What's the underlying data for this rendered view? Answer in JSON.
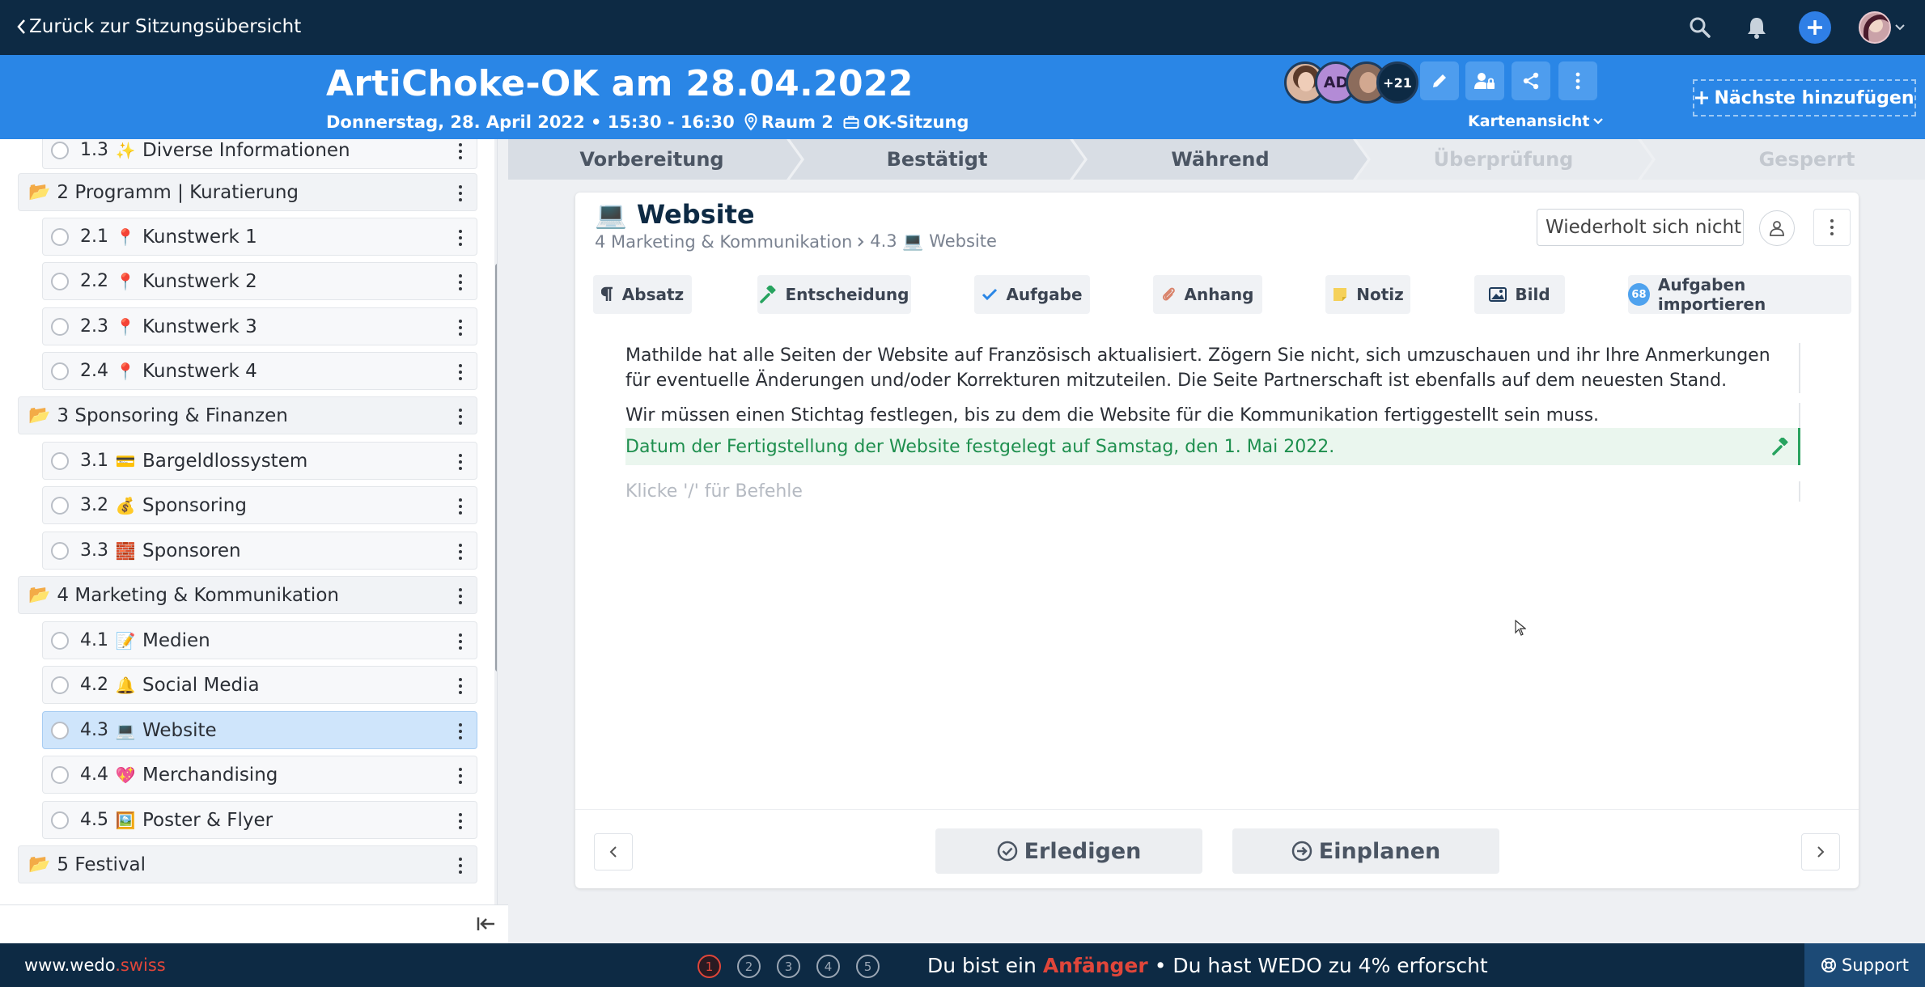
{
  "topbar": {
    "back_label": "Zurück zur Sitzungsübersicht",
    "icons": [
      "search-icon",
      "bell-icon",
      "plus-icon",
      "user-avatar"
    ]
  },
  "meeting": {
    "title": "ArtiChoke-OK am 28.04.2022",
    "date_time": "Donnerstag, 28. April 2022 • 15:30 - 16:30",
    "room": "Raum 2",
    "type": "OK-Sitzung",
    "participants": [
      "",
      "AD",
      "",
      "+21"
    ],
    "view_label": "Kartenansicht",
    "add_next_label": "Nächste hinzufügen"
  },
  "sidebar": {
    "sections": [
      {
        "kind": "item",
        "number": "1.3",
        "emoji": "✨",
        "label": "Diverse Informationen"
      },
      {
        "kind": "section",
        "label": "2 Programm | Kuratierung"
      },
      {
        "kind": "item",
        "number": "2.1",
        "emoji": "📍",
        "label": "Kunstwerk 1"
      },
      {
        "kind": "item",
        "number": "2.2",
        "emoji": "📍",
        "label": "Kunstwerk 2"
      },
      {
        "kind": "item",
        "number": "2.3",
        "emoji": "📍",
        "label": "Kunstwerk 3"
      },
      {
        "kind": "item",
        "number": "2.4",
        "emoji": "📍",
        "label": "Kunstwerk 4"
      },
      {
        "kind": "section",
        "label": "3 Sponsoring & Finanzen"
      },
      {
        "kind": "item",
        "number": "3.1",
        "emoji": "💳",
        "label": "Bargeldlossystem"
      },
      {
        "kind": "item",
        "number": "3.2",
        "emoji": "💰",
        "label": "Sponsoring"
      },
      {
        "kind": "item",
        "number": "3.3",
        "emoji": "🧱",
        "label": "Sponsoren"
      },
      {
        "kind": "section",
        "label": "4 Marketing & Kommunikation"
      },
      {
        "kind": "item",
        "number": "4.1",
        "emoji": "📝",
        "label": "Medien"
      },
      {
        "kind": "item",
        "number": "4.2",
        "emoji": "🔔",
        "label": "Social Media"
      },
      {
        "kind": "item",
        "number": "4.3",
        "emoji": "💻",
        "label": "Website",
        "active": true
      },
      {
        "kind": "item",
        "number": "4.4",
        "emoji": "💖",
        "label": "Merchandising"
      },
      {
        "kind": "item",
        "number": "4.5",
        "emoji": "🖼️",
        "label": "Poster & Flyer"
      },
      {
        "kind": "section",
        "label": "5 Festival"
      }
    ]
  },
  "stages": [
    "Vorbereitung",
    "Bestätigt",
    "Während",
    "Überprüfung",
    "Gesperrt"
  ],
  "card": {
    "emoji": "💻",
    "title": "Website",
    "breadcrumb_section": "4 Marketing & Kommunikation",
    "breadcrumb_item": "4.3 💻 Website",
    "repeat_label": "Wiederholt sich nicht",
    "toolbar": {
      "absatz": "Absatz",
      "entscheidung": "Entscheidung",
      "aufgabe": "Aufgabe",
      "anhang": "Anhang",
      "notiz": "Notiz",
      "bild": "Bild",
      "import_count": "68",
      "import": "Aufgaben importieren"
    },
    "paragraph1": "Mathilde hat alle Seiten der Website auf Französisch aktualisiert. Zögern Sie nicht, sich umzuschauen und ihr Ihre Anmerkungen für eventuelle Änderungen und/oder Korrekturen mitzuteilen. Die Seite Partnerschaft ist ebenfalls auf dem neuesten Stand.",
    "paragraph2": "Wir müssen einen Stichtag festlegen, bis zu dem die Website für die Kommunikation fertiggestellt sein muss.",
    "decision": "Datum der Fertigstellung der Website festgelegt auf Samstag, den 1. Mai 2022.",
    "placeholder": "Klicke '/' für Befehle",
    "complete_label": "Erledigen",
    "schedule_label": "Einplanen"
  },
  "footer": {
    "site_main": "www.wedo",
    "site_accent": ".swiss",
    "steps": [
      "1",
      "2",
      "3",
      "4",
      "5"
    ],
    "current_step": 1,
    "progress_prefix": "Du bist ein",
    "level": "Anfänger",
    "progress_suffix": "• Du hast WEDO zu 4% erforscht",
    "support_label": "Support"
  },
  "colors": {
    "navy": "#0d2a44",
    "brand_blue": "#2a86e6",
    "accent_red": "#e0463a",
    "decision_green": "#1e8f4e"
  }
}
